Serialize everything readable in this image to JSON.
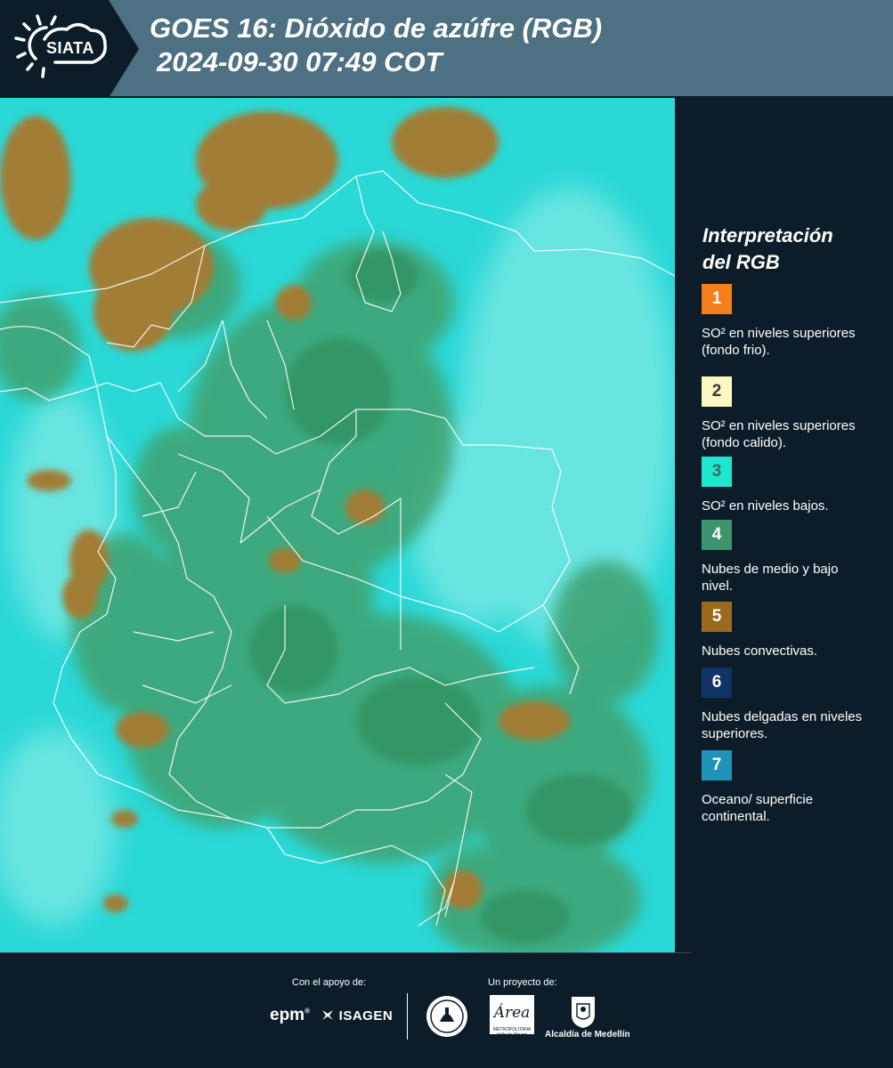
{
  "header": {
    "logo_text": "SIATA",
    "title_line1": "GOES 16: Dióxido de azúfre (RGB)",
    "title_line2": "2024-09-30 07:49 COT"
  },
  "legend": {
    "title_line1": "Interpretación",
    "title_line2": "del RGB",
    "items": [
      {
        "number": "1",
        "label": "SO² en niveles superiores (fondo frio).",
        "color": "#f57f1b",
        "text_color": "#ffffff"
      },
      {
        "number": "2",
        "label": "SO² en niveles superiores (fondo calido).",
        "color": "#fdf7c3",
        "text_color": "#3a3a3a"
      },
      {
        "number": "3",
        "label": "SO² en niveles bajos.",
        "color": "#1fe7cf",
        "text_color": "#3a6a60"
      },
      {
        "number": "4",
        "label": "Nubes de medio y bajo nivel.",
        "color": "#3c936e",
        "text_color": "#ffffff"
      },
      {
        "number": "5",
        "label": "Nubes convectivas.",
        "color": "#9b6a1c",
        "text_color": "#ffffff"
      },
      {
        "number": "6",
        "label": "Nubes delgadas en niveles superiores.",
        "color": "#113466",
        "text_color": "#ffffff"
      },
      {
        "number": "7",
        "label": "Oceano/ superficie continental.",
        "color": "#1e92b8",
        "text_color": "#ffffff"
      }
    ]
  },
  "map": {
    "colors": {
      "clear_cyan": "#2ad8d6",
      "light_cyan": "#6fe7e3",
      "mid_cloud_green": "#3fa574",
      "dark_green": "#2f8f5e",
      "convective": "#a27d35",
      "border_line": "#ffffff"
    }
  },
  "footer": {
    "support_label": "Con el apoyo de:",
    "project_label": "Un proyecto de:",
    "epm": "epm",
    "epm_reg": "®",
    "isagen": "ISAGEN",
    "area_word": "Área",
    "area_sub": "METROPOLITANA Valle de Aburrá",
    "alcaldia": "Alcaldía de Medellín"
  }
}
